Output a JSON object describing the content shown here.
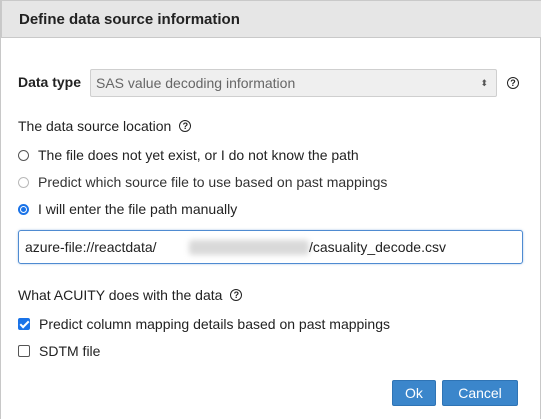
{
  "dialog": {
    "title": "Define data source information"
  },
  "data_type": {
    "label": "Data type",
    "selected": "SAS value decoding information",
    "arrows": "⬍",
    "help_icon": "?"
  },
  "location": {
    "label": "The data source location",
    "help_icon": "?",
    "options": [
      {
        "label": "The file does not yet exist, or I do not know the path",
        "checked": false,
        "disabled": false
      },
      {
        "label": "Predict which source file to use based on past mappings",
        "checked": false,
        "disabled": true
      },
      {
        "label": "I will enter the file path manually",
        "checked": true,
        "disabled": false
      }
    ],
    "path_prefix": "azure-file://reactdata/",
    "path_suffix": "/casuality_decode.csv"
  },
  "acuity": {
    "label": "What ACUITY does with the data",
    "help_icon": "?",
    "options": [
      {
        "label": "Predict column mapping details based on past mappings",
        "checked": true
      },
      {
        "label": "SDTM file",
        "checked": false
      }
    ]
  },
  "buttons": {
    "ok": "Ok",
    "cancel": "Cancel"
  },
  "colors": {
    "accent": "#1a73e8",
    "button": "#3b86cb",
    "header_bg": "#e6e6e6"
  }
}
